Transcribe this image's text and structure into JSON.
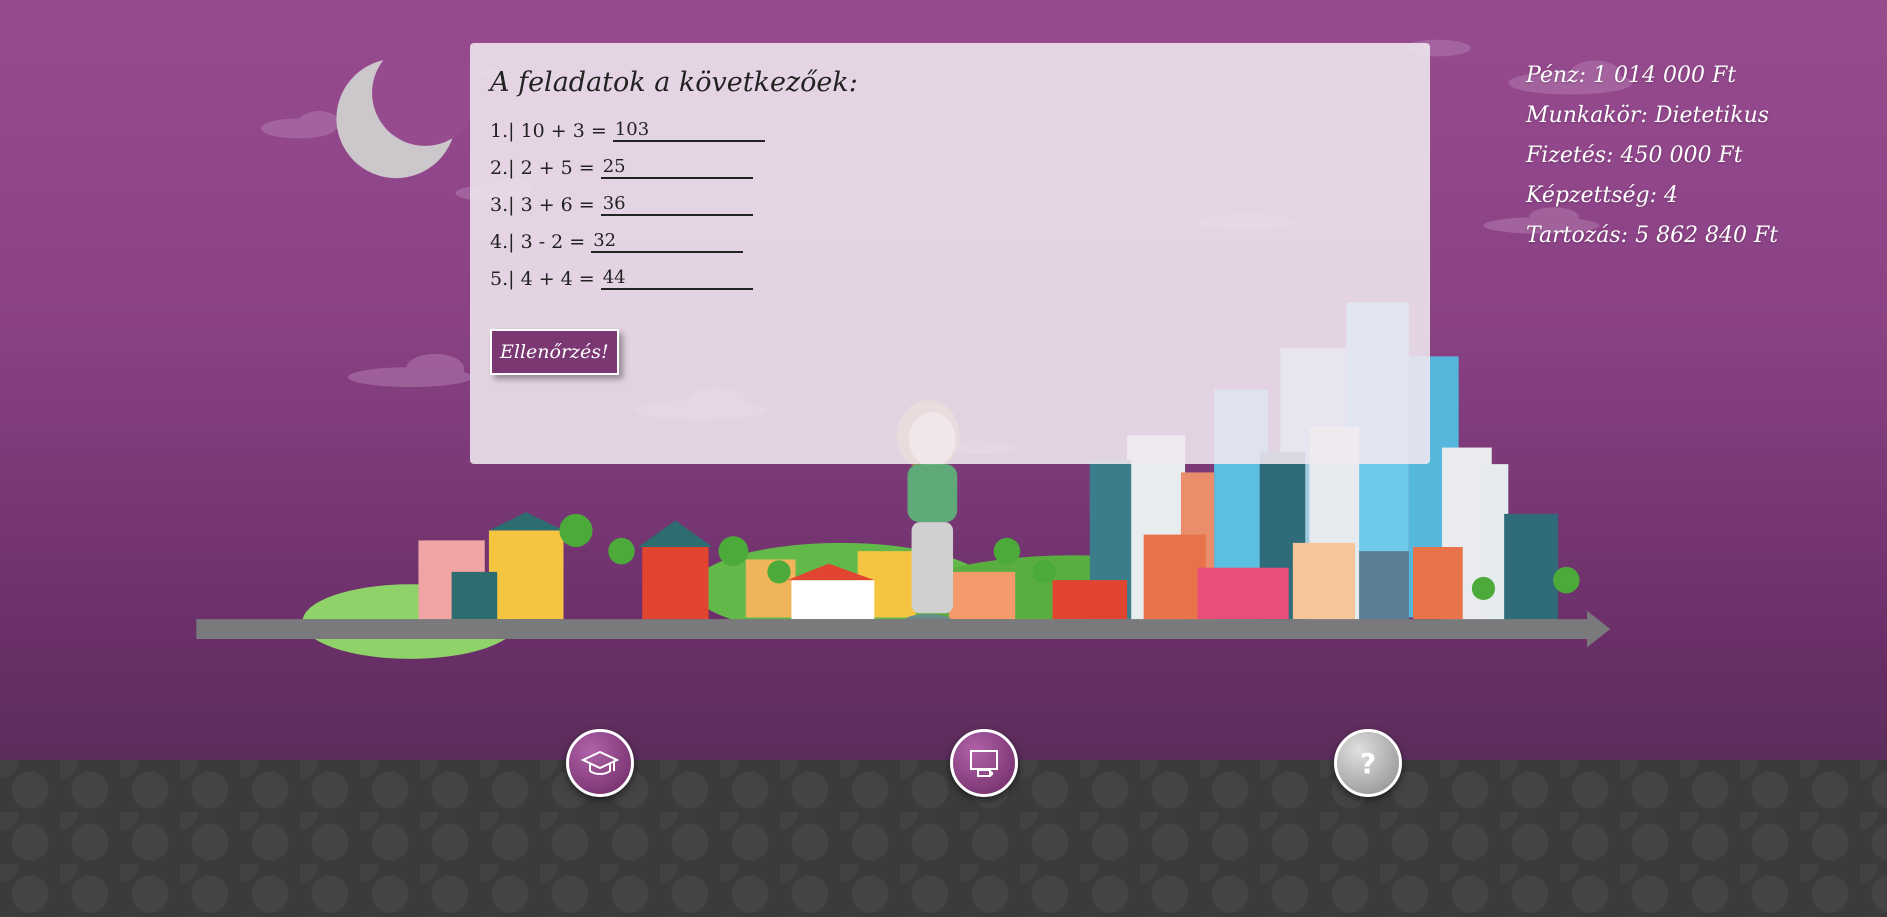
{
  "panel": {
    "title": "A feladatok a következőek:",
    "tasks": [
      {
        "label": "1.| 10 + 3 =",
        "answer": "103"
      },
      {
        "label": "2.| 2 + 5 =",
        "answer": "25"
      },
      {
        "label": "3.| 3 + 6 =",
        "answer": "36"
      },
      {
        "label": "4.| 3 - 2 =",
        "answer": "32"
      },
      {
        "label": "5.| 4 + 4 =",
        "answer": "44"
      }
    ],
    "check_button": "Ellenőrzés!"
  },
  "stats": {
    "money": "Pénz: 1 014 000 Ft",
    "job": "Munkakör: Dietetikus",
    "salary": "Fizetés: 450 000 Ft",
    "education": "Képzettség: 4",
    "debt": "Tartozás: 5 862 840 Ft"
  },
  "timeline": {
    "nodes": [
      {
        "icon": "graduation-cap-icon",
        "state": "active"
      },
      {
        "icon": "coffee-break-icon",
        "state": "active"
      },
      {
        "icon": "question-mark-icon",
        "label": "?",
        "state": "locked"
      }
    ]
  },
  "colors": {
    "sky": "#974b8f",
    "panel": "#f0e8f0",
    "button": "#7a3772",
    "ground": "#3b3b3d",
    "road": "#7a7a7c"
  }
}
